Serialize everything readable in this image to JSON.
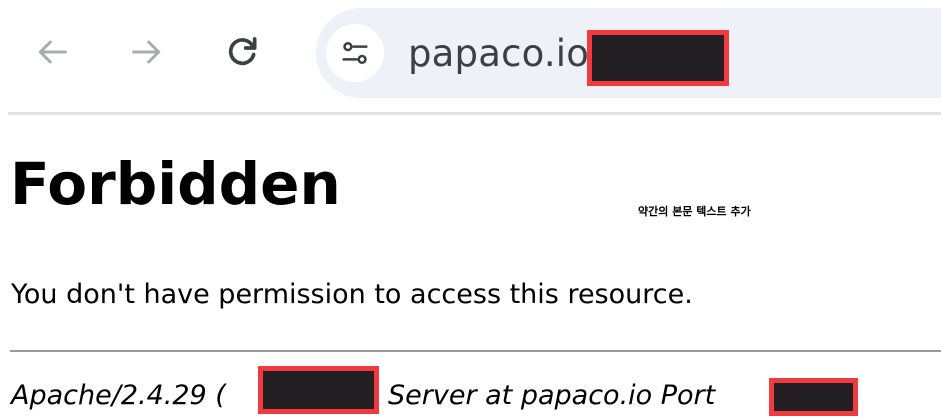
{
  "browser": {
    "back_icon": "arrow-left-icon",
    "forward_icon": "arrow-right-icon",
    "reload_icon": "reload-icon",
    "site_info_icon": "tune-icon",
    "url": "papaco.io/",
    "colors": {
      "nav_disabled": "#a8abaf",
      "nav_enabled": "#3c4043",
      "omnibox_bg": "#eef1f8",
      "redaction_fill": "#231f22",
      "redaction_border": "#f03a3e"
    }
  },
  "content": {
    "heading": "Forbidden",
    "annotation": "약간의 본문 텍스트 추가",
    "message": "You don't have permission to access this resource.",
    "footer": {
      "server_prefix": "Apache/2.4.29 (",
      "server_middle": "Server at papaco.io Port"
    }
  }
}
